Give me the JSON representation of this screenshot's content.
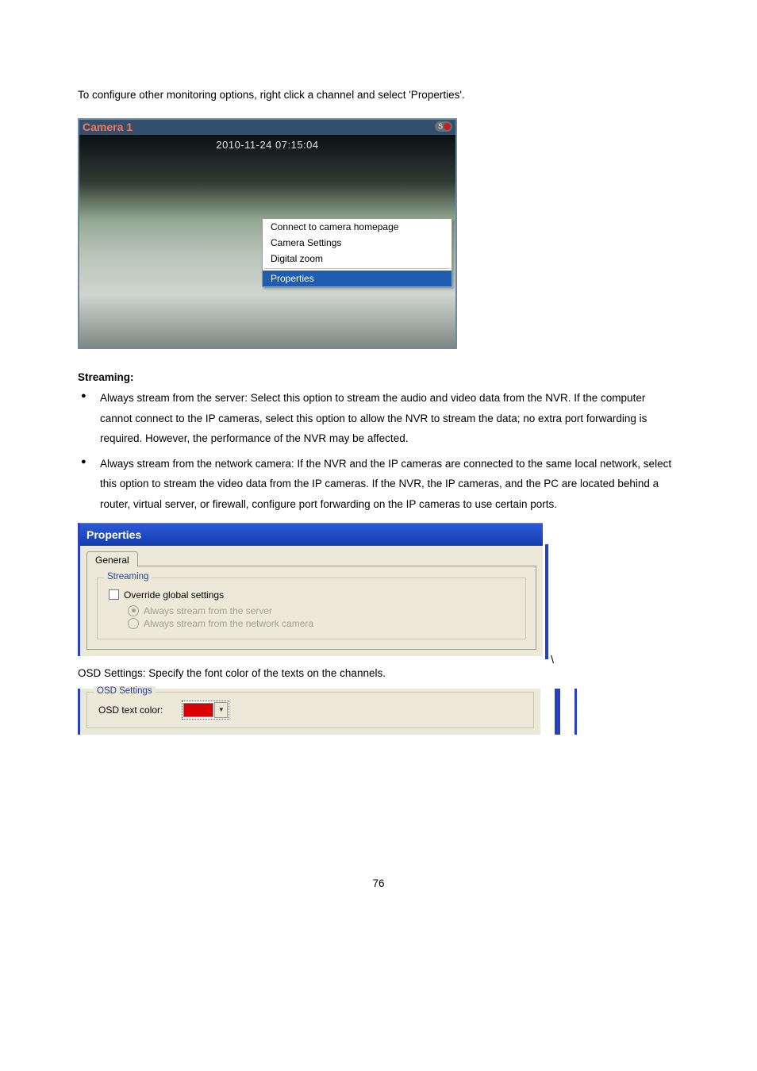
{
  "intro": "To configure other monitoring options, right click a channel and select 'Properties'.",
  "fig1": {
    "title": "Camera 1",
    "badge_letter": "S",
    "timestamp": "2010-11-24 07:15:04",
    "menu": {
      "items": [
        "Connect to camera homepage",
        "Camera Settings",
        "Digital zoom"
      ],
      "selected": "Properties"
    }
  },
  "heading": "Streaming:",
  "bullets": [
    "Always stream from the server: Select this option to stream the audio and video data from the NVR.   If the computer cannot connect to the IP cameras, select this option to allow the NVR to stream the data; no extra port forwarding is required.   However, the performance of the NVR may be affected.",
    "Always stream from the network camera: If the NVR and the IP cameras are connected to the same local network, select this option to stream the video data from the IP cameras.   If the NVR, the IP cameras, and the PC are located behind a router, virtual server, or firewall, configure port forwarding on the IP cameras to use certain ports."
  ],
  "fig2": {
    "title": "Properties",
    "tab": "General",
    "group": "Streaming",
    "checkbox": "Override global settings",
    "radio_server": "Always stream from the server",
    "radio_camera": "Always stream from the network camera",
    "tick": "\\"
  },
  "osd_caption": "OSD Settings: Specify the font color of the texts on the channels.",
  "fig3": {
    "group": "OSD Settings",
    "label": "OSD text color:",
    "color": "#d80000",
    "arrow": "▼"
  },
  "page_number": "76"
}
